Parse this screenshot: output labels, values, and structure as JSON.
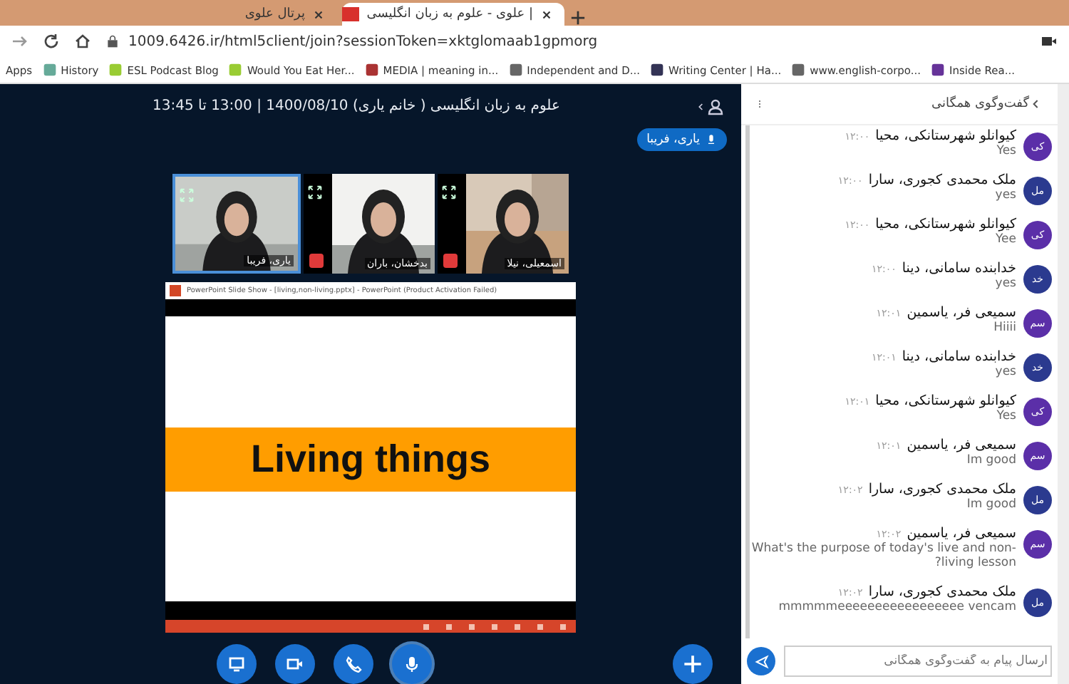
{
  "browser": {
    "tabs": [
      {
        "title": "علوی - علوم به زبان انگلیسی |",
        "selected": true
      },
      {
        "title": "پرتال علوی",
        "selected": false
      }
    ],
    "url": "1009.6426.ir/html5client/join?sessionToken=xktglomaab1gpmorg",
    "bookmarks": [
      "Inside Rea...",
      "www.english-corpo...",
      "Writing Center | Ha...",
      "Independent and D...",
      "MEDIA | meaning in...",
      "Would You Eat Her...",
      "ESL Podcast Blog",
      "History",
      "Apps"
    ]
  },
  "meeting": {
    "title": "علوم به زبان انگلیسی ( خانم یاری) 1400/08/10 | 13:00 تا 13:45",
    "speaker": "یاری، فریبا",
    "tiles": [
      {
        "name": "اسمعیلی، نیلا",
        "selected": false,
        "muted": true
      },
      {
        "name": "بدخشان، باران",
        "selected": false,
        "muted": true
      },
      {
        "name": "یاری، فریبا",
        "selected": true,
        "muted": false
      }
    ],
    "slide": {
      "window_title": "PowerPoint Slide Show - [living,non-living.pptx] - PowerPoint (Product Activation Failed)",
      "heading": "Living things"
    },
    "controls": [
      {
        "kind": "screen"
      },
      {
        "kind": "camera"
      },
      {
        "kind": "phone"
      },
      {
        "kind": "mic"
      }
    ]
  },
  "chat": {
    "title": "گفت‌وگوی همگانی",
    "placeholder": "ارسال پیام به گفت‌وگوی همگانی",
    "messages": [
      {
        "initials": "کی",
        "color": "#5b2fa8",
        "sender": "کیوانلو شهرستانکی، محیا",
        "time": "۱۲:۰۰",
        "text": "Yes"
      },
      {
        "initials": "مل",
        "color": "#2b3a8f",
        "sender": "ملک محمدی کجوری، سارا",
        "time": "۱۲:۰۰",
        "text": "yes"
      },
      {
        "initials": "کی",
        "color": "#5b2fa8",
        "sender": "کیوانلو شهرستانکی، محیا",
        "time": "۱۲:۰۰",
        "text": "Yee"
      },
      {
        "initials": "خد",
        "color": "#2b3a8f",
        "sender": "خدابنده سامانی، دینا",
        "time": "۱۲:۰۰",
        "text": "yes"
      },
      {
        "initials": "سم",
        "color": "#5b2fa8",
        "sender": "سمیعی فر، یاسمین",
        "time": "۱۲:۰۱",
        "text": "Hiiii"
      },
      {
        "initials": "خد",
        "color": "#2b3a8f",
        "sender": "خدابنده سامانی، دینا",
        "time": "۱۲:۰۱",
        "text": "yes"
      },
      {
        "initials": "کی",
        "color": "#5b2fa8",
        "sender": "کیوانلو شهرستانکی، محیا",
        "time": "۱۲:۰۱",
        "text": "Yes"
      },
      {
        "initials": "سم",
        "color": "#5b2fa8",
        "sender": "سمیعی فر، یاسمین",
        "time": "۱۲:۰۱",
        "text": "Im good"
      },
      {
        "initials": "مل",
        "color": "#2b3a8f",
        "sender": "ملک محمدی کجوری، سارا",
        "time": "۱۲:۰۲",
        "text": "Im good"
      },
      {
        "initials": "سم",
        "color": "#5b2fa8",
        "sender": "سمیعی فر، یاسمین",
        "time": "۱۲:۰۲",
        "text": "What's the purpose of today's live and non-living lesson?"
      },
      {
        "initials": "مل",
        "color": "#2b3a8f",
        "sender": "ملک محمدی کجوری، سارا",
        "time": "۱۲:۰۲",
        "text": "mmmmmeeeeeeeeeeeeeeeee vencam"
      }
    ]
  }
}
